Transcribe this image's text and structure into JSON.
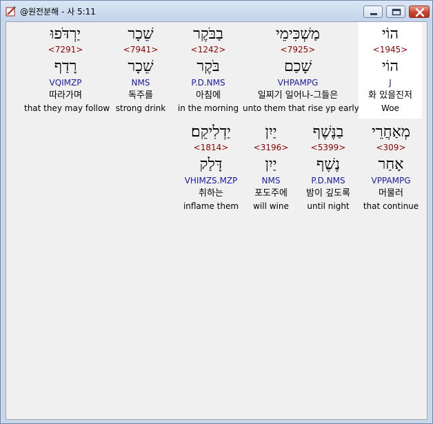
{
  "window": {
    "title": "@원전분해 - 사 5:11",
    "icon": "pencil-book-icon"
  },
  "rows": [
    {
      "words": [
        {
          "heb": "יַרְדֹּפוּ",
          "strong": "<7291>",
          "lemma": "רָדַף",
          "morph": "VQIMZP",
          "korean": "따라가며",
          "english": "that they may follow"
        },
        {
          "heb": "שֵׁכָר",
          "strong": "<7941>",
          "lemma": "שֵׁכָר",
          "morph": "NMS",
          "korean": "독주를",
          "english": "strong drink"
        },
        {
          "heb": "בַבֹּקֶר",
          "strong": "<1242>",
          "lemma": "בֹּקֶר",
          "morph": "P.D.NMS",
          "korean": "아침에",
          "english": "in the morning"
        },
        {
          "heb": "מַשְׁכִּימֵי",
          "strong": "<7925>",
          "lemma": "שָׁכַם",
          "morph": "VHPAMPG",
          "korean": "일찌기 일어나-그들은",
          "english": "unto them that rise yp early"
        },
        {
          "heb": "הוֹי",
          "strong": "<1945>",
          "lemma": "הוֹי",
          "morph": "J",
          "korean": "화 있을진저",
          "english": "Woe"
        }
      ]
    },
    {
      "words": [
        {
          "heb": "יַדְלִיקֵם׃",
          "strong": "<1814>",
          "lemma": "דָּלַק",
          "morph": "VHIMZS.MZP",
          "korean": "취하는",
          "english": "inflame them"
        },
        {
          "heb": "יַיִן",
          "strong": "<3196>",
          "lemma": "יַיִן",
          "morph": "NMS",
          "korean": "포도주에",
          "english": "will wine"
        },
        {
          "heb": "בַנֶּשֶׁף",
          "strong": "<5399>",
          "lemma": "נֶשֶׁף",
          "morph": "P.D.NMS",
          "korean": "밤이 깊도록",
          "english": "until night"
        },
        {
          "heb": "מְאַחֲרֵי",
          "strong": "<309>",
          "lemma": "אָחַר",
          "morph": "VPPAMPG",
          "korean": "머물러",
          "english": "that continue"
        }
      ]
    }
  ],
  "colors": {
    "strong": "#8b0000",
    "morph": "#1a1aa6",
    "highlight": "#ffffff"
  }
}
